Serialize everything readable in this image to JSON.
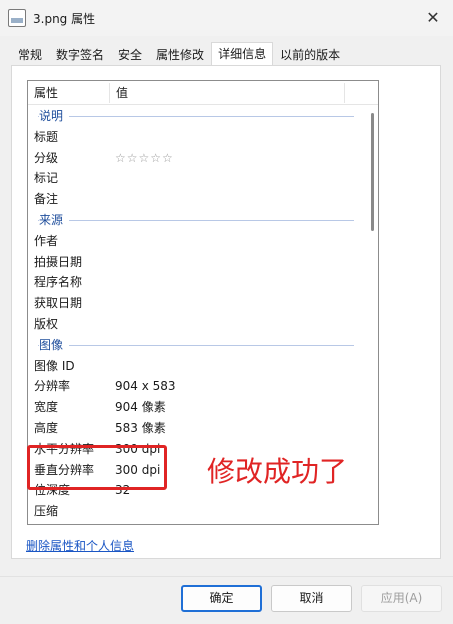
{
  "window": {
    "title": "3.png 属性",
    "close_glyph": "✕"
  },
  "tabs": [
    "常规",
    "数字签名",
    "安全",
    "属性修改",
    "详细信息",
    "以前的版本"
  ],
  "active_tab": "详细信息",
  "columns": {
    "property": "属性",
    "value": "值"
  },
  "rows": [
    {
      "type": "group",
      "label": "说明"
    },
    {
      "type": "item",
      "prop": "标题",
      "val": ""
    },
    {
      "type": "item",
      "prop": "分级",
      "val": "☆☆☆☆☆",
      "stars": true
    },
    {
      "type": "item",
      "prop": "标记",
      "val": ""
    },
    {
      "type": "item",
      "prop": "备注",
      "val": ""
    },
    {
      "type": "group",
      "label": "来源"
    },
    {
      "type": "item",
      "prop": "作者",
      "val": ""
    },
    {
      "type": "item",
      "prop": "拍摄日期",
      "val": ""
    },
    {
      "type": "item",
      "prop": "程序名称",
      "val": ""
    },
    {
      "type": "item",
      "prop": "获取日期",
      "val": ""
    },
    {
      "type": "item",
      "prop": "版权",
      "val": ""
    },
    {
      "type": "group",
      "label": "图像"
    },
    {
      "type": "item",
      "prop": "图像 ID",
      "val": ""
    },
    {
      "type": "item",
      "prop": "分辨率",
      "val": "904 x 583"
    },
    {
      "type": "item",
      "prop": "宽度",
      "val": "904 像素"
    },
    {
      "type": "item",
      "prop": "高度",
      "val": "583 像素"
    },
    {
      "type": "item",
      "prop": "水平分辨率",
      "val": "300 dpi"
    },
    {
      "type": "item",
      "prop": "垂直分辨率",
      "val": "300 dpi"
    },
    {
      "type": "item",
      "prop": "位深度",
      "val": "32"
    },
    {
      "type": "item",
      "prop": "压缩",
      "val": ""
    }
  ],
  "annotation": "修改成功了",
  "remove_link": "删除属性和个人信息",
  "buttons": {
    "ok": "确定",
    "cancel": "取消",
    "apply": "应用(A)"
  },
  "colors": {
    "highlight": "#e02424",
    "link": "#1a56c4",
    "group_label": "#1f4e9c",
    "ok_border": "#1f6fd6"
  }
}
